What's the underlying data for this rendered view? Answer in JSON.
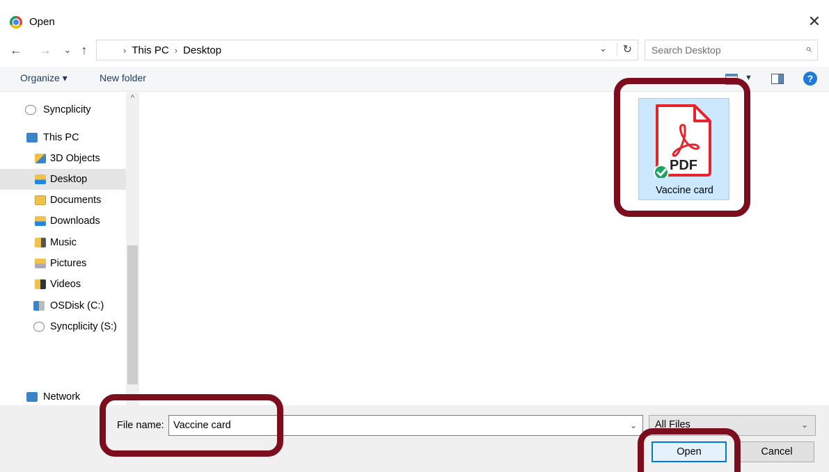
{
  "window": {
    "title": "Open",
    "close_glyph": "✕"
  },
  "nav": {
    "back": "←",
    "forward": "→",
    "recent": "⌄",
    "up": "↑",
    "path": [
      "This PC",
      "Desktop"
    ],
    "path_sep": "›",
    "search_placeholder": "Search Desktop"
  },
  "toolbar": {
    "organize": "Organize ▾",
    "new_folder": "New folder",
    "help": "?"
  },
  "sidebar": {
    "items": [
      {
        "label": "Syncplicity",
        "icon": "cloud-icon"
      },
      {
        "label": "This PC",
        "icon": "pc-icon"
      },
      {
        "label": "3D Objects",
        "icon": "folder-3d-icon"
      },
      {
        "label": "Desktop",
        "icon": "desktop-folder-icon",
        "selected": true
      },
      {
        "label": "Documents",
        "icon": "documents-folder-icon"
      },
      {
        "label": "Downloads",
        "icon": "downloads-folder-icon"
      },
      {
        "label": "Music",
        "icon": "music-folder-icon"
      },
      {
        "label": "Pictures",
        "icon": "pictures-folder-icon"
      },
      {
        "label": "Videos",
        "icon": "videos-folder-icon"
      },
      {
        "label": "OSDisk (C:)",
        "icon": "drive-icon"
      },
      {
        "label": "Syncplicity (S:)",
        "icon": "cloud-drive-icon"
      },
      {
        "label": "Network",
        "icon": "network-icon"
      }
    ]
  },
  "content": {
    "files": [
      {
        "name": "Vaccine card",
        "type_label": "PDF",
        "selected": true
      }
    ]
  },
  "footer": {
    "file_name_label": "File name:",
    "file_name_value": "Vaccine card",
    "filter_value": "All Files",
    "open_label": "Open",
    "cancel_label": "Cancel"
  },
  "colors": {
    "highlight": "#7b0d1e",
    "accent": "#0078d7",
    "selection": "#cce8ff",
    "pdf_red": "#e3262d"
  }
}
